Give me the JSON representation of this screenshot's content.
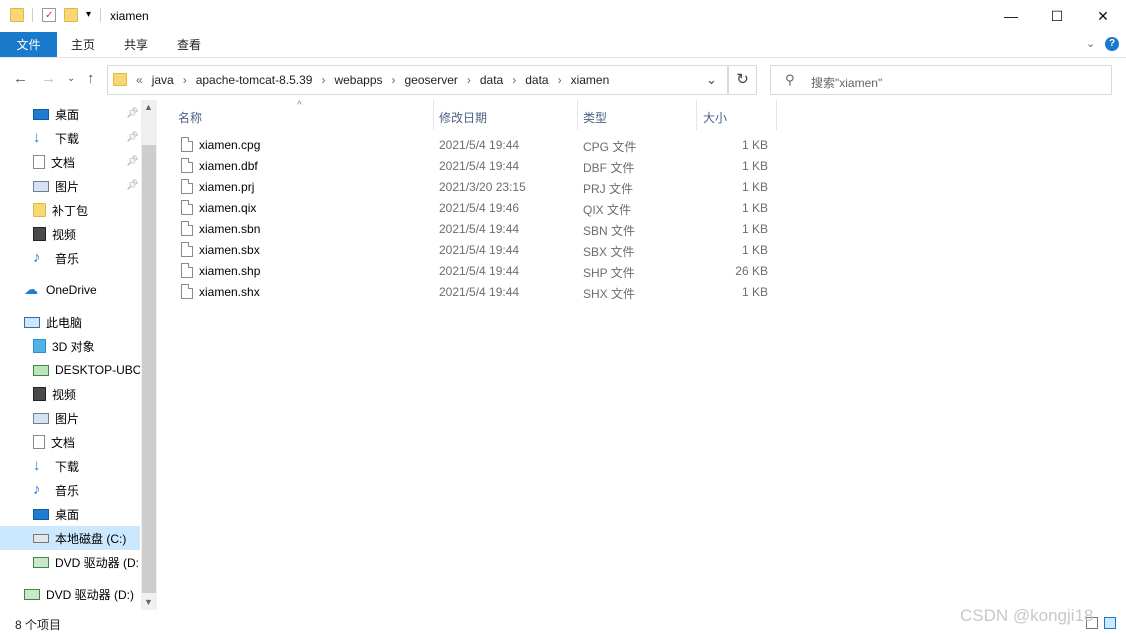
{
  "window": {
    "title": "xiamen",
    "min": "—",
    "max": "☐",
    "close": "✕"
  },
  "ribbon": {
    "file": "文件",
    "tabs": [
      "主页",
      "共享",
      "查看"
    ]
  },
  "address": {
    "crumbs": [
      "java",
      "apache-tomcat-8.5.39",
      "webapps",
      "geoserver",
      "data",
      "data",
      "xiamen"
    ],
    "overflow": "«",
    "dropdown": "⌄",
    "refresh": "↻"
  },
  "search": {
    "placeholder": "搜索\"xiamen\""
  },
  "nav": {
    "quick": [
      {
        "label": "桌面",
        "icon": "desktop-icon",
        "pinned": true
      },
      {
        "label": "下载",
        "icon": "download-icon",
        "pinned": true
      },
      {
        "label": "文档",
        "icon": "document-icon",
        "pinned": true
      },
      {
        "label": "图片",
        "icon": "picture-icon",
        "pinned": true
      },
      {
        "label": "补丁包",
        "icon": "folder-icon"
      },
      {
        "label": "视频",
        "icon": "video-icon"
      },
      {
        "label": "音乐",
        "icon": "music-icon"
      }
    ],
    "onedrive": "OneDrive",
    "thispc": "此电脑",
    "pc": [
      {
        "label": "3D 对象",
        "icon": "3d-objects-icon"
      },
      {
        "label": "DESKTOP-UBO",
        "icon": "network-pc-icon"
      },
      {
        "label": "视频",
        "icon": "video-icon"
      },
      {
        "label": "图片",
        "icon": "picture-icon"
      },
      {
        "label": "文档",
        "icon": "document-icon"
      },
      {
        "label": "下载",
        "icon": "download-icon"
      },
      {
        "label": "音乐",
        "icon": "music-icon"
      },
      {
        "label": "桌面",
        "icon": "desktop-icon"
      },
      {
        "label": "本地磁盘 (C:)",
        "icon": "drive-icon",
        "selected": true
      },
      {
        "label": "DVD 驱动器 (D:",
        "icon": "dvd-icon"
      }
    ],
    "dvd": "DVD 驱动器 (D:)"
  },
  "columns": {
    "name": "名称",
    "date": "修改日期",
    "type": "类型",
    "size": "大小"
  },
  "files": [
    {
      "name": "xiamen.cpg",
      "date": "2021/5/4 19:44",
      "type": "CPG 文件",
      "size": "1 KB"
    },
    {
      "name": "xiamen.dbf",
      "date": "2021/5/4 19:44",
      "type": "DBF 文件",
      "size": "1 KB"
    },
    {
      "name": "xiamen.prj",
      "date": "2021/3/20 23:15",
      "type": "PRJ 文件",
      "size": "1 KB"
    },
    {
      "name": "xiamen.qix",
      "date": "2021/5/4 19:46",
      "type": "QIX 文件",
      "size": "1 KB"
    },
    {
      "name": "xiamen.sbn",
      "date": "2021/5/4 19:44",
      "type": "SBN 文件",
      "size": "1 KB"
    },
    {
      "name": "xiamen.sbx",
      "date": "2021/5/4 19:44",
      "type": "SBX 文件",
      "size": "1 KB"
    },
    {
      "name": "xiamen.shp",
      "date": "2021/5/4 19:44",
      "type": "SHP 文件",
      "size": "26 KB"
    },
    {
      "name": "xiamen.shx",
      "date": "2021/5/4 19:44",
      "type": "SHX 文件",
      "size": "1 KB"
    }
  ],
  "status": {
    "count": "8 个项目"
  },
  "watermark": "CSDN @kongji18",
  "colors": {
    "accent": "#1979ca",
    "selected": "#cce8ff",
    "header": "#4d6185"
  }
}
